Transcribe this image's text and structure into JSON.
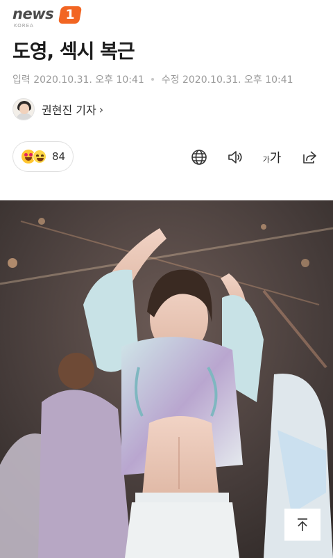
{
  "header": {
    "logo_word": "news",
    "logo_number": "1",
    "logo_sub": "KOREA"
  },
  "article": {
    "title": "도영, 섹시 복근",
    "published_label": "입력",
    "published": "2020.10.31. 오후 10:41",
    "modified_label": "수정",
    "modified": "2020.10.31. 오후 10:41",
    "reporter": "권현진 기자",
    "reporter_chevron": "›"
  },
  "toolbar": {
    "reaction_count": "84",
    "reaction_icons": [
      "heart-eyes-emoji",
      "smile-emoji"
    ],
    "tools": [
      "globe-icon",
      "speaker-icon",
      "font-size-icon",
      "share-icon"
    ],
    "font_small": "가",
    "font_big": "가"
  },
  "photo": {
    "description_icon": "performer-photo",
    "scroll_top_icon": "arrow-up-icon"
  }
}
